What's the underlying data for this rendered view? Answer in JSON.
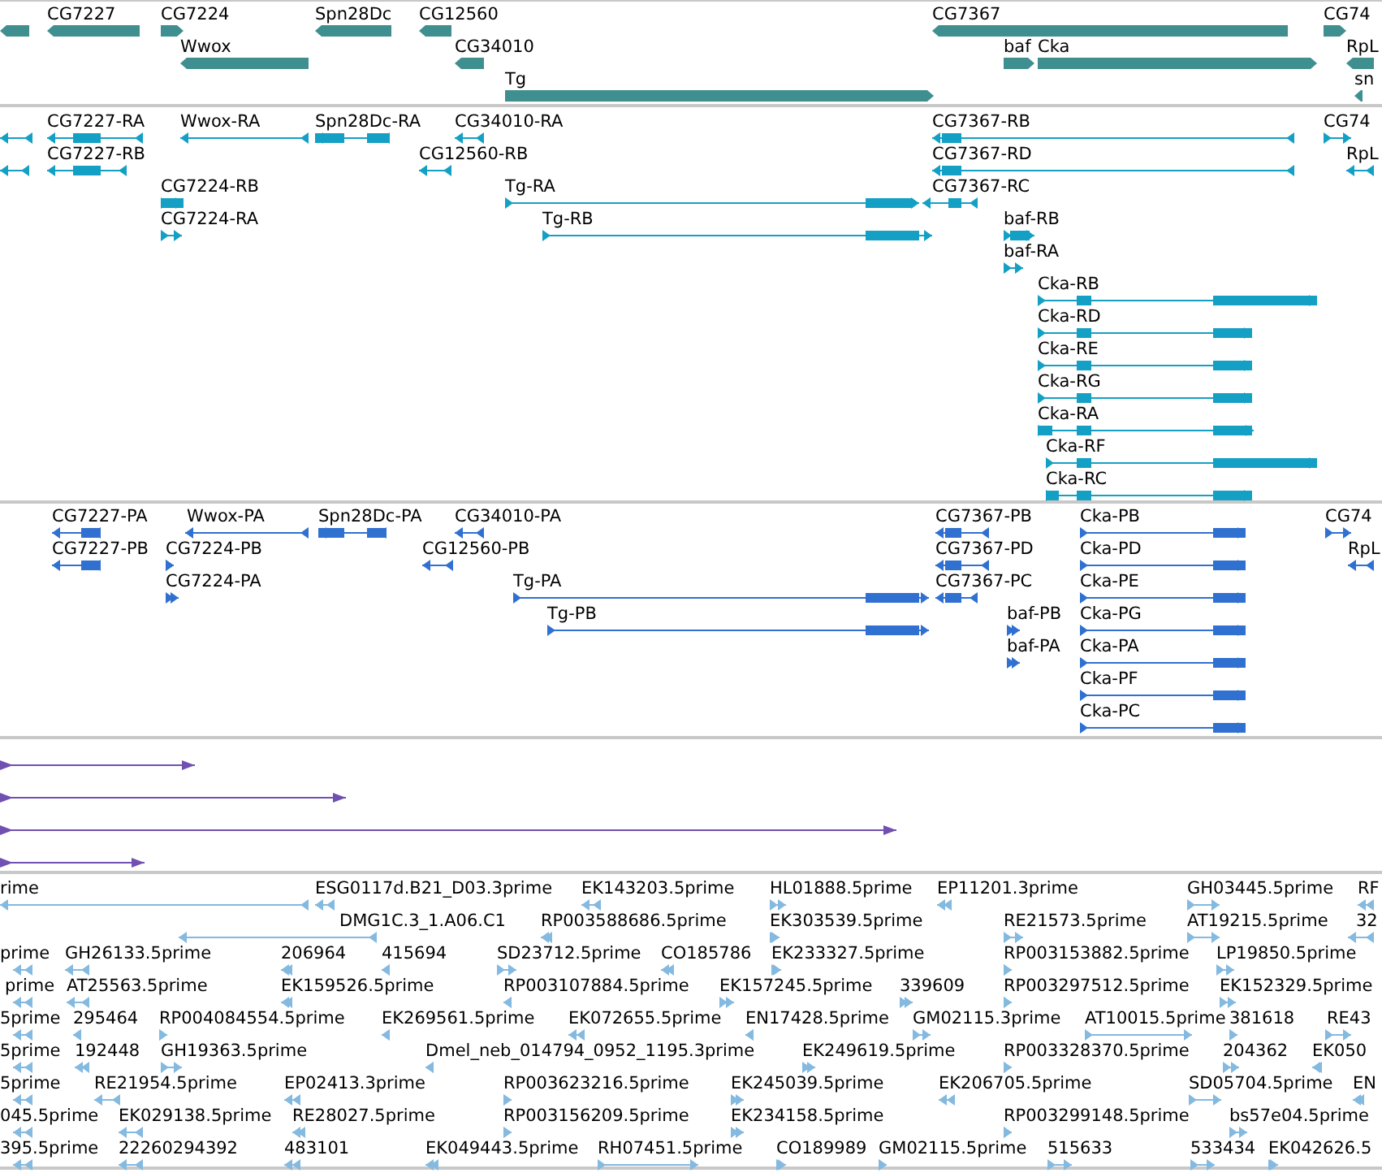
{
  "tracks": [
    {
      "kind": "gene",
      "features": [
        {
          "reverse": true
        },
        {
          "label": "CG7227",
          "reverse": true
        },
        {
          "label": "CG7224",
          "reverse": false
        },
        {
          "label": "Spn28Dc",
          "reverse": true
        },
        {
          "label": "CG12560",
          "reverse": true
        },
        {
          "label": "CG7367",
          "reverse": true
        },
        {
          "label": "CG74",
          "reverse": false
        },
        {
          "label": "Wwox",
          "reverse": true
        },
        {
          "label": "CG34010",
          "reverse": true
        },
        {
          "label": "baf",
          "reverse": false
        },
        {
          "label": "Cka",
          "reverse": false
        },
        {
          "label": "RpL",
          "reverse": true
        },
        {
          "label": "Tg",
          "reverse": false
        },
        {
          "label": "sn",
          "reverse": true
        }
      ]
    },
    {
      "kind": "transcript",
      "features": [
        {
          "reverse": true
        },
        {
          "label": "CG7227-RA",
          "reverse": true
        },
        {
          "label": "Wwox-RA",
          "reverse": true
        },
        {
          "label": "Spn28Dc-RA",
          "reverse": true
        },
        {
          "label": "CG34010-RA",
          "reverse": true
        },
        {
          "label": "CG7367-RB",
          "reverse": true
        },
        {
          "label": "CG74",
          "reverse": false
        },
        {
          "reverse": true
        },
        {
          "label": "CG7227-RB",
          "reverse": true
        },
        {
          "label": "CG12560-RB",
          "reverse": true
        },
        {
          "label": "CG7367-RD",
          "reverse": true
        },
        {
          "label": "RpL",
          "reverse": true
        },
        {
          "label": "CG7224-RB",
          "reverse": false
        },
        {
          "label": "Tg-RA",
          "reverse": false
        },
        {
          "label": "CG7367-RC",
          "reverse": true
        },
        {
          "label": "CG7224-RA",
          "reverse": false
        },
        {
          "label": "Tg-RB",
          "reverse": false
        },
        {
          "label": "baf-RB",
          "reverse": false
        },
        {
          "label": "baf-RA",
          "reverse": false
        },
        {
          "label": "Cka-RB",
          "reverse": false
        },
        {
          "label": "Cka-RD",
          "reverse": false
        },
        {
          "label": "Cka-RE",
          "reverse": false
        },
        {
          "label": "Cka-RG",
          "reverse": false
        },
        {
          "label": "Cka-RA",
          "reverse": false
        },
        {
          "label": "Cka-RF",
          "reverse": false
        },
        {
          "label": "Cka-RC",
          "reverse": false
        }
      ]
    },
    {
      "kind": "protein",
      "features": [
        {
          "label": "CG7227-PA",
          "reverse": true
        },
        {
          "label": "Wwox-PA",
          "reverse": true
        },
        {
          "label": "Spn28Dc-PA",
          "reverse": true
        },
        {
          "label": "CG34010-PA",
          "reverse": true
        },
        {
          "label": "CG7367-PB",
          "reverse": true
        },
        {
          "label": "Cka-PB",
          "reverse": false
        },
        {
          "label": "CG74",
          "reverse": false
        },
        {
          "label": "CG7227-PB",
          "reverse": true
        },
        {
          "label": "CG7224-PB",
          "reverse": false
        },
        {
          "label": "CG12560-PB",
          "reverse": true
        },
        {
          "label": "CG7367-PD",
          "reverse": true
        },
        {
          "label": "Cka-PD",
          "reverse": false
        },
        {
          "label": "RpL",
          "reverse": true
        },
        {
          "label": "CG7224-PA",
          "reverse": false
        },
        {
          "label": "Tg-PA",
          "reverse": false
        },
        {
          "label": "CG7367-PC",
          "reverse": true
        },
        {
          "label": "Cka-PE",
          "reverse": false
        },
        {
          "label": "Tg-PB",
          "reverse": false
        },
        {
          "label": "baf-PB",
          "reverse": false
        },
        {
          "label": "Cka-PG",
          "reverse": false
        },
        {
          "label": "baf-PA",
          "reverse": false
        },
        {
          "label": "Cka-PA",
          "reverse": false
        },
        {
          "label": "Cka-PF",
          "reverse": false
        },
        {
          "label": "Cka-PC",
          "reverse": false
        }
      ]
    },
    {
      "kind": "alignment",
      "features": [
        {
          "reverse": false
        },
        {
          "reverse": false
        },
        {
          "reverse": false
        },
        {
          "reverse": false
        }
      ]
    },
    {
      "kind": "est",
      "features": [
        {
          "label": "rime",
          "reverse": true
        },
        {
          "label": "ESG0117d.B21_D03.3prime",
          "reverse": true
        },
        {
          "label": "EK143203.5prime",
          "reverse": true
        },
        {
          "label": "HL01888.5prime",
          "reverse": false
        },
        {
          "label": "EP11201.3prime",
          "reverse": true
        },
        {
          "label": "GH03445.5prime",
          "reverse": false
        },
        {
          "label": "RF",
          "reverse": true
        },
        {
          "label": "DMG1C.3_1.A06.C1",
          "reverse": true
        },
        {
          "label": "RP003588686.5prime",
          "reverse": true
        },
        {
          "label": "EK303539.5prime",
          "reverse": false
        },
        {
          "label": "RE21573.5prime",
          "reverse": false
        },
        {
          "label": "AT19215.5prime",
          "reverse": false
        },
        {
          "label": "32",
          "reverse": true
        },
        {
          "label": "prime",
          "reverse": true
        },
        {
          "label": "GH26133.5prime",
          "reverse": true
        },
        {
          "label": "206964",
          "reverse": true
        },
        {
          "label": "415694",
          "reverse": true
        },
        {
          "label": "SD23712.5prime",
          "reverse": false
        },
        {
          "label": "CO185786",
          "reverse": true
        },
        {
          "label": "EK233327.5prime",
          "reverse": false
        },
        {
          "label": "RP003153882.5prime",
          "reverse": false
        },
        {
          "label": "LP19850.5prime",
          "reverse": false
        },
        {
          "label": "prime",
          "reverse": true
        },
        {
          "label": "AT25563.5prime",
          "reverse": true
        },
        {
          "label": "EK159526.5prime",
          "reverse": true
        },
        {
          "label": "RP003107884.5prime",
          "reverse": true
        },
        {
          "label": "EK157245.5prime",
          "reverse": false
        },
        {
          "label": "339609",
          "reverse": false
        },
        {
          "label": "RP003297512.5prime",
          "reverse": false
        },
        {
          "label": "EK152329.5prime",
          "reverse": false
        },
        {
          "label": "5prime",
          "reverse": true
        },
        {
          "label": "295464",
          "reverse": true
        },
        {
          "label": "RP004084554.5prime",
          "reverse": false
        },
        {
          "label": "EK269561.5prime",
          "reverse": true
        },
        {
          "label": "EK072655.5prime",
          "reverse": true
        },
        {
          "label": "EN17428.5prime",
          "reverse": true
        },
        {
          "label": "GM02115.3prime",
          "reverse": false
        },
        {
          "label": "AT10015.5prime",
          "reverse": false
        },
        {
          "label": "381618",
          "reverse": false
        },
        {
          "label": "RE43",
          "reverse": false
        },
        {
          "label": "5prime",
          "reverse": true
        },
        {
          "label": "192448",
          "reverse": true
        },
        {
          "label": "GH19363.5prime",
          "reverse": false
        },
        {
          "label": "Dmel_neb_014794_0952_1195.3prime",
          "reverse": true
        },
        {
          "label": "EK249619.5prime",
          "reverse": false
        },
        {
          "label": "RP003328370.5prime",
          "reverse": false
        },
        {
          "label": "204362",
          "reverse": false
        },
        {
          "label": "EK050",
          "reverse": true
        },
        {
          "label": "5prime",
          "reverse": true
        },
        {
          "label": "RE21954.5prime",
          "reverse": true
        },
        {
          "label": "EP02413.3prime",
          "reverse": true
        },
        {
          "label": "RP003623216.5prime",
          "reverse": false
        },
        {
          "label": "EK245039.5prime",
          "reverse": false
        },
        {
          "label": "EK206705.5prime",
          "reverse": true
        },
        {
          "label": "SD05704.5prime",
          "reverse": false
        },
        {
          "label": "EN",
          "reverse": true
        },
        {
          "label": "045.5prime",
          "reverse": true
        },
        {
          "label": "EK029138.5prime",
          "reverse": true
        },
        {
          "label": "RE28027.5prime",
          "reverse": true
        },
        {
          "label": "RP003156209.5prime",
          "reverse": false
        },
        {
          "label": "EK234158.5prime",
          "reverse": false
        },
        {
          "label": "RP003299148.5prime",
          "reverse": false
        },
        {
          "label": "bs57e04.5prime",
          "reverse": false
        },
        {
          "label": "395.5prime",
          "reverse": true
        },
        {
          "label": "22260294392",
          "reverse": true
        },
        {
          "label": "483101",
          "reverse": true
        },
        {
          "label": "EK049443.5prime",
          "reverse": true
        },
        {
          "label": "RH07451.5prime",
          "reverse": false
        },
        {
          "label": "CO189989",
          "reverse": false
        },
        {
          "label": "GM02115.5prime",
          "reverse": false
        },
        {
          "label": "515633",
          "reverse": false
        },
        {
          "label": "533434",
          "reverse": false
        },
        {
          "label": "EK042626.5",
          "reverse": false
        }
      ]
    }
  ]
}
